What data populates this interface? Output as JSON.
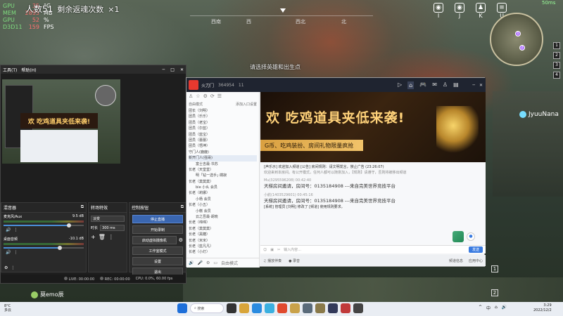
{
  "game": {
    "stats": [
      {
        "k": "GPU",
        "v": "35",
        "u": "°C"
      },
      {
        "k": "MEM",
        "v": "2895",
        "u": "MB"
      },
      {
        "k": "GPU",
        "v": "52",
        "u": "%"
      },
      {
        "k": "D3D11",
        "v": "159",
        "u": "FPS"
      }
    ],
    "alive_label": "人数51",
    "revive_label": "剩余返魂次数",
    "revive_count": "×1",
    "compass": [
      "西南",
      "西",
      "西北",
      "北"
    ],
    "compass_heading": "西",
    "select_hint": "请选择英雄和出生点",
    "ping": "50ms",
    "teammate_name": "JyuuNana",
    "player_name": "莫emo辰",
    "map_marks": [
      "1",
      "2"
    ],
    "side_badges": [
      "1",
      "2",
      "3",
      "4"
    ],
    "hud_icons": [
      {
        "label": "I",
        "name": "mic-icon"
      },
      {
        "label": "J",
        "name": "mic-icon"
      },
      {
        "label": "K",
        "name": "team-icon"
      },
      {
        "label": "U",
        "name": "menu-icon"
      }
    ]
  },
  "obs": {
    "menu": [
      "工具(T)",
      "帮助(H)"
    ],
    "preview_banner": "欢 吃鸡道具夹低来袭!",
    "mixer": {
      "title": "混音器",
      "tracks": [
        {
          "name": "麦克风/Aux",
          "db": "9.5 dB",
          "level": 0.82
        },
        {
          "name": "桌面音频",
          "db": "-10.1 dB",
          "level": 0.7
        }
      ]
    },
    "transition": {
      "title": "转场特效",
      "type": "淡变",
      "duration_label": "时长",
      "duration": "300 ms"
    },
    "controls": {
      "title": "控制按钮",
      "buttons": [
        "停止直播",
        "开始录制",
        "启动虚拟摄像机",
        "工作室模式",
        "设置",
        "退出"
      ]
    },
    "status": {
      "live": "LIVE: 00:00:00",
      "rec": "REC: 00:00:00",
      "cpu": "CPU: 0.0%, 60.00 fps"
    }
  },
  "chat": {
    "room": "火刀门",
    "room_id": "364954",
    "online": "11",
    "mode": "自由模式",
    "mode_right": "添加入口设置",
    "channels": [
      {
        "t": "团长（刘明）",
        "lvl": 0
      },
      {
        "t": "团员（乐乐）",
        "lvl": 0
      },
      {
        "t": "团员（老宝）",
        "lvl": 0
      },
      {
        "t": "团员（尔蓝）",
        "lvl": 0
      },
      {
        "t": "团员（蓝宝）",
        "lvl": 0
      },
      {
        "t": "团员（蕾蕾）",
        "lvl": 0
      },
      {
        "t": "团员（悟坤）",
        "lvl": 0
      },
      {
        "t": "守门人(鹿鹿)",
        "lvl": 0
      },
      {
        "t": "新开门人(强哥)",
        "lvl": 0
      },
      {
        "t": "富士吉最·书苏",
        "lvl": 1
      },
      {
        "t": "长老（天堂堂）",
        "lvl": 0
      },
      {
        "t": "明「钻一选手」·嫦寂",
        "lvl": 1
      },
      {
        "t": "长老（莫莫莫）",
        "lvl": 0
      },
      {
        "t": "bie 小幺 会员",
        "lvl": 1
      },
      {
        "t": "长老（莉娜）",
        "lvl": 0
      },
      {
        "t": "小杨 会员",
        "lvl": 1
      },
      {
        "t": "长老（小五）",
        "lvl": 0
      },
      {
        "t": "小糕 会员",
        "lvl": 1
      },
      {
        "t": "云之吾最·胡晓",
        "lvl": 1
      },
      {
        "t": "长老（绵绵）",
        "lvl": 0
      },
      {
        "t": "长老（莫莫莫）",
        "lvl": 0
      },
      {
        "t": "长老（黑糖）",
        "lvl": 0
      },
      {
        "t": "长老（米米）",
        "lvl": 0
      },
      {
        "t": "长老（蓝凡凡）",
        "lvl": 0
      },
      {
        "t": "长老（小灯）",
        "lvl": 0
      }
    ],
    "banner_head": "欢 吃鸡道具夹低来袭!",
    "banner_sub": "G币、吃鸡装扮、房间礼物限量疯抢",
    "messages": [
      {
        "k": "sys",
        "t": "[声乐示]  欢迎加入频道 [公告] 房间规则：请文明发言，禁止广告 (23:26:07)"
      },
      {
        "k": "sys2",
        "t": "欢迎来到本房间。有公开模式，任何人都可以随意加入，【规则】请遵守，否则将被移出频道"
      },
      {
        "k": "name",
        "t": "Mu(3295596208)   00:42:40"
      },
      {
        "k": "big",
        "t": "天梯房间邀请，房间号：0135184908 ---来自完美世界竞技平台"
      },
      {
        "k": "name",
        "t": "小航(1403529601)   00:45:16"
      },
      {
        "k": "big",
        "t": "天梯房间邀请，房间号：0135184908 ---来自完美世界竞技平台"
      },
      {
        "k": "sys",
        "t": "[系统]   管理员 [刘明] 修改了 [频道] 使用规则要求。"
      }
    ],
    "input_placeholder": "输入内容...",
    "send": "发送",
    "bottom": [
      "自由模式",
      "播放伴奏",
      "录音"
    ],
    "bottom_right": [
      "频道信息",
      "应用中心"
    ]
  },
  "taskbar": {
    "weather_temp": "8°C",
    "weather_desc": "多云",
    "search": "搜索",
    "lang": "中",
    "time": "3:29",
    "date": "2022/12/2"
  }
}
